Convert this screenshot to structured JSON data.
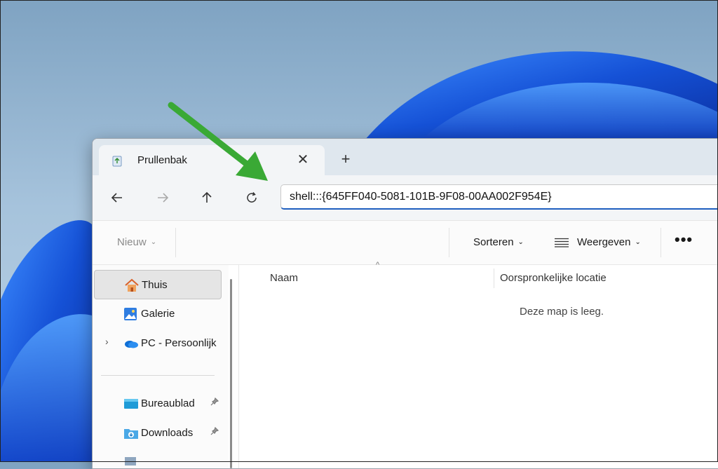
{
  "tab": {
    "title": "Prullenbak",
    "close_glyph": "✕",
    "new_tab_glyph": "+"
  },
  "address": {
    "value": "shell:::{645FF040-5081-101B-9F08-00AA002F954E}"
  },
  "toolbar": {
    "new_label": "Nieuw",
    "sort_label": "Sorteren",
    "view_label": "Weergeven",
    "more_label": "•••",
    "chevron": "⌄"
  },
  "sidebar": {
    "items": [
      {
        "label": "Thuis",
        "icon": "home-icon"
      },
      {
        "label": "Galerie",
        "icon": "gallery-icon"
      },
      {
        "label": "PC - Persoonlijk",
        "icon": "onedrive-icon",
        "expander": "›"
      },
      {
        "label": "Bureaublad",
        "icon": "desktop-folder-icon",
        "pin": "📌"
      },
      {
        "label": "Downloads",
        "icon": "downloads-folder-icon",
        "pin": "📌"
      }
    ]
  },
  "columns": {
    "name": "Naam",
    "location": "Oorspronkelijke locatie",
    "sort_glyph": "^"
  },
  "empty_message": "Deze map is leeg.",
  "colors": {
    "accent": "#1f5fbf",
    "arrow": "#3aa935",
    "wallpaper_blue": "#1a5ce0"
  }
}
